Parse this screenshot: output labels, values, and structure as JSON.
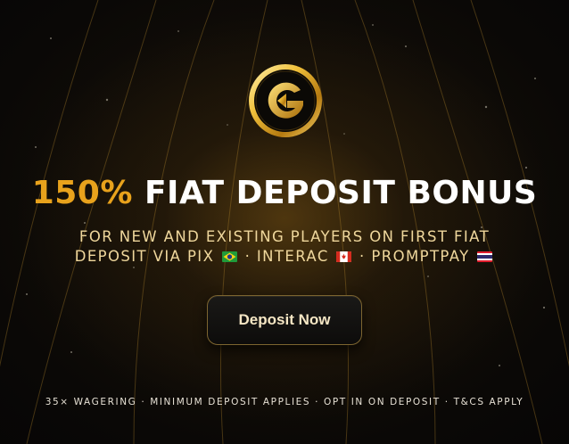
{
  "promo": {
    "headline_accent": "150%",
    "headline_rest": "FIAT DEPOSIT BONUS",
    "subtitle_line1": "FOR NEW AND EXISTING PLAYERS ON FIRST FIAT",
    "subtitle_line2_prefix": "DEPOSIT VIA PIX",
    "separator": "·",
    "method_interac": "INTERAC",
    "method_promptpay": "PROMPTPAY",
    "cta_label": "Deposit Now",
    "footer": "35× WAGERING · MINIMUM DEPOSIT APPLIES · OPT IN ON DEPOSIT · T&CS APPLY"
  },
  "icons": {
    "logo": "gold-g-coin-logo",
    "flag_pix": "brazil-flag-icon",
    "flag_interac": "canada-flag-icon",
    "flag_promptpay": "thailand-flag-icon"
  },
  "colors": {
    "accent_gold": "#e8a21c",
    "subtitle_cream": "#efd79c",
    "background": "#070605",
    "button_border": "#7d6530"
  }
}
